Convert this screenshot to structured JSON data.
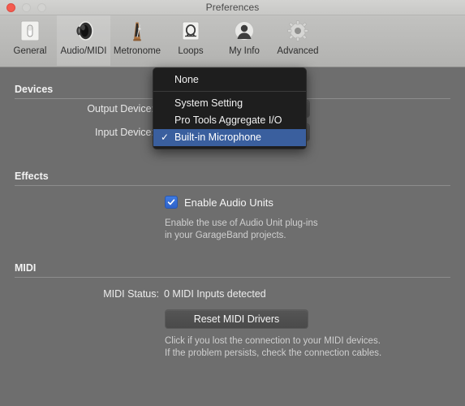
{
  "window": {
    "title": "Preferences",
    "traffic_lights": [
      "close-button",
      "minimize-button",
      "maximize-button"
    ]
  },
  "toolbar": {
    "tabs": [
      {
        "label": "General",
        "icon": "general-icon",
        "selected": false
      },
      {
        "label": "Audio/MIDI",
        "icon": "audio-midi-icon",
        "selected": true
      },
      {
        "label": "Metronome",
        "icon": "metronome-icon",
        "selected": false
      },
      {
        "label": "Loops",
        "icon": "loops-icon",
        "selected": false
      },
      {
        "label": "My Info",
        "icon": "my-info-icon",
        "selected": false
      },
      {
        "label": "Advanced",
        "icon": "advanced-icon",
        "selected": false
      }
    ]
  },
  "devices": {
    "section_title": "Devices",
    "output_label": "Output Device:",
    "input_label": "Input Device:"
  },
  "dropdown": {
    "open": true,
    "belongs_to": "input-device-popup",
    "items": [
      {
        "label": "None",
        "checked": false,
        "separator_after": true
      },
      {
        "label": "System Setting",
        "checked": false,
        "separator_after": false
      },
      {
        "label": "Pro Tools Aggregate I/O",
        "checked": false,
        "separator_after": false
      },
      {
        "label": "Built-in Microphone",
        "checked": true,
        "separator_after": false
      }
    ],
    "checkmark": "✓",
    "selected_value": "Built-in Microphone",
    "highlight_color": "#3a5f9e",
    "background_color": "#1e1e1e"
  },
  "effects": {
    "section_title": "Effects",
    "checkbox_label": "Enable Audio Units",
    "checkbox_checked": true,
    "checkbox_color": "#3070d8",
    "help_line_1": "Enable the use of Audio Unit plug-ins",
    "help_line_2": "in your GarageBand projects."
  },
  "midi": {
    "section_title": "MIDI",
    "status_label": "MIDI Status:",
    "status_value": "0 MIDI Inputs detected",
    "reset_button_label": "Reset MIDI Drivers",
    "help_line_1": "Click if you lost the connection to your MIDI devices.",
    "help_line_2": "If the problem persists, check the connection cables."
  }
}
